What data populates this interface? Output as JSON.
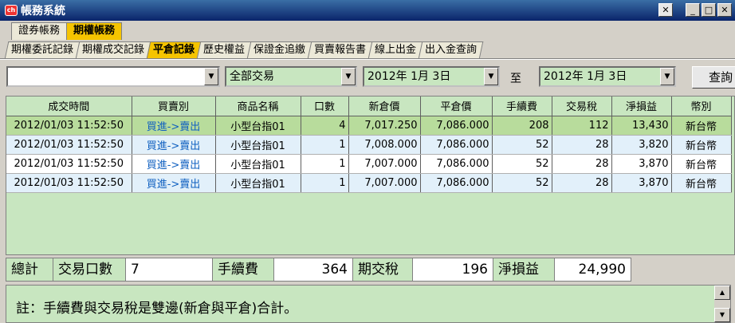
{
  "window": {
    "title": "帳務系統",
    "icon_text": "ch"
  },
  "main_tabs": [
    {
      "label": "證券帳務"
    },
    {
      "label": "期權帳務"
    }
  ],
  "sub_tabs": [
    {
      "label": "期權委託記錄"
    },
    {
      "label": "期權成交記錄"
    },
    {
      "label": "平倉記錄"
    },
    {
      "label": "歷史權益"
    },
    {
      "label": "保證金追繳"
    },
    {
      "label": "買賣報告書"
    },
    {
      "label": "線上出金"
    },
    {
      "label": "出入金查詢"
    }
  ],
  "filters": {
    "account": "",
    "trade_type": "全部交易",
    "start_date": "2012年  1月  3日",
    "to_label": "至",
    "end_date": "2012年  1月  3日",
    "query_label": "查詢"
  },
  "table": {
    "columns": [
      "成交時間",
      "買賣別",
      "商品名稱",
      "口數",
      "新倉價",
      "平倉價",
      "手續費",
      "交易稅",
      "淨損益",
      "幣別"
    ],
    "rows": [
      [
        "2012/01/03 11:52:50",
        "買進->賣出",
        "小型台指01",
        "4",
        "7,017.250",
        "7,086.000",
        "208",
        "112",
        "13,430",
        "新台幣"
      ],
      [
        "2012/01/03 11:52:50",
        "買進->賣出",
        "小型台指01",
        "1",
        "7,008.000",
        "7,086.000",
        "52",
        "28",
        "3,820",
        "新台幣"
      ],
      [
        "2012/01/03 11:52:50",
        "買進->賣出",
        "小型台指01",
        "1",
        "7,007.000",
        "7,086.000",
        "52",
        "28",
        "3,870",
        "新台幣"
      ],
      [
        "2012/01/03 11:52:50",
        "買進->賣出",
        "小型台指01",
        "1",
        "7,007.000",
        "7,086.000",
        "52",
        "28",
        "3,870",
        "新台幣"
      ]
    ]
  },
  "summary": {
    "total_label": "總計",
    "lots_label": "交易口數",
    "lots_value": "7",
    "fee_label": "手續費",
    "fee_value": "364",
    "tax_label": "期交稅",
    "tax_value": "196",
    "pnl_label": "淨損益",
    "pnl_value": "24,990"
  },
  "note": "註：手續費與交易稅是雙邊(新倉與平倉)合計。",
  "colors": {
    "active_tab": "#f5c400",
    "panel_green": "#c8e6c0",
    "row_highlight": "#b8dc9c",
    "buysell_text": "#1060c0"
  }
}
